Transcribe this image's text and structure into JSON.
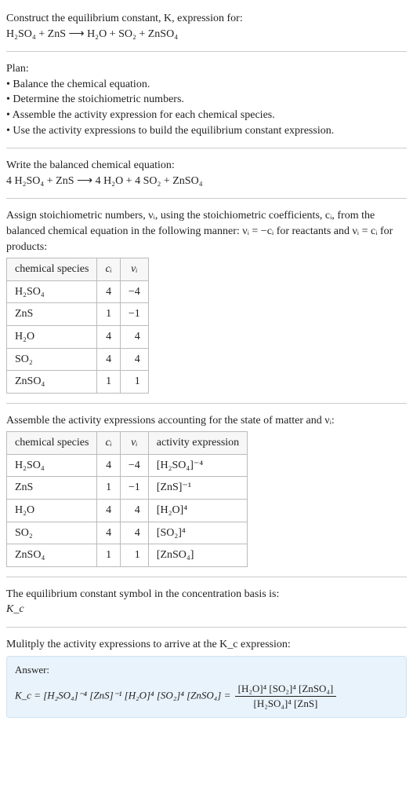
{
  "header": {
    "title_line1": "Construct the equilibrium constant, K, expression for:",
    "equation_unbalanced": "H₂SO₄ + ZnS ⟶ H₂O + SO₂ + ZnSO₄"
  },
  "plan": {
    "heading": "Plan:",
    "items": [
      "• Balance the chemical equation.",
      "• Determine the stoichiometric numbers.",
      "• Assemble the activity expression for each chemical species.",
      "• Use the activity expressions to build the equilibrium constant expression."
    ]
  },
  "balanced": {
    "heading": "Write the balanced chemical equation:",
    "equation": "4 H₂SO₄ + ZnS ⟶ 4 H₂O + 4 SO₂ + ZnSO₄"
  },
  "stoich": {
    "heading_part1": "Assign stoichiometric numbers, νᵢ, using the stoichiometric coefficients, cᵢ, from the balanced chemical equation in the following manner: νᵢ = −cᵢ for reactants and νᵢ = cᵢ for products:",
    "cols": [
      "chemical species",
      "cᵢ",
      "νᵢ"
    ],
    "rows": [
      {
        "species": "H₂SO₄",
        "c": "4",
        "v": "−4"
      },
      {
        "species": "ZnS",
        "c": "1",
        "v": "−1"
      },
      {
        "species": "H₂O",
        "c": "4",
        "v": "4"
      },
      {
        "species": "SO₂",
        "c": "4",
        "v": "4"
      },
      {
        "species": "ZnSO₄",
        "c": "1",
        "v": "1"
      }
    ]
  },
  "activity": {
    "heading": "Assemble the activity expressions accounting for the state of matter and νᵢ:",
    "cols": [
      "chemical species",
      "cᵢ",
      "νᵢ",
      "activity expression"
    ],
    "rows": [
      {
        "species": "H₂SO₄",
        "c": "4",
        "v": "−4",
        "expr": "[H₂SO₄]⁻⁴"
      },
      {
        "species": "ZnS",
        "c": "1",
        "v": "−1",
        "expr": "[ZnS]⁻¹"
      },
      {
        "species": "H₂O",
        "c": "4",
        "v": "4",
        "expr": "[H₂O]⁴"
      },
      {
        "species": "SO₂",
        "c": "4",
        "v": "4",
        "expr": "[SO₂]⁴"
      },
      {
        "species": "ZnSO₄",
        "c": "1",
        "v": "1",
        "expr": "[ZnSO₄]"
      }
    ]
  },
  "kc_symbol": {
    "heading": "The equilibrium constant symbol in the concentration basis is:",
    "symbol": "K_c"
  },
  "multiply": {
    "heading": "Mulitply the activity expressions to arrive at the K_c expression:"
  },
  "answer": {
    "label": "Answer:",
    "lhs": "K_c = [H₂SO₄]⁻⁴ [ZnS]⁻¹ [H₂O]⁴ [SO₂]⁴ [ZnSO₄] =",
    "frac_num": "[H₂O]⁴ [SO₂]⁴ [ZnSO₄]",
    "frac_den": "[H₂SO₄]⁴ [ZnS]"
  }
}
